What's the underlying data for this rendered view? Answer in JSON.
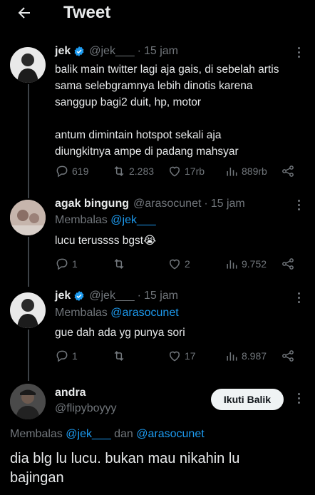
{
  "header": {
    "title": "Tweet"
  },
  "tweets": [
    {
      "name": "jek",
      "handle": "@jek___",
      "time": "15 jam",
      "text_lines": [
        "balik main twitter lagi aja gais, di sebelah artis",
        "sama selebgramnya lebih dinotis karena",
        "sanggup bagi2 duit, hp, motor",
        "",
        "antum dimintain hotspot sekali aja",
        "diungkitnya ampe di padang mahsyar"
      ],
      "replies": "619",
      "retweets": "2.283",
      "likes": "17rb",
      "views": "889rb"
    },
    {
      "name": "agak bingung",
      "handle": "@arasocunet",
      "time": "15 jam",
      "replying_label": "Membalas",
      "replying_to": "@jek___",
      "text": "lucu terussss bgst😭",
      "replies": "1",
      "retweets": "",
      "likes": "2",
      "views": "9.752"
    },
    {
      "name": "jek",
      "handle": "@jek___",
      "time": "15 jam",
      "replying_label": "Membalas",
      "replying_to": "@arasocunet",
      "text": "gue dah ada yg punya sori",
      "replies": "1",
      "retweets": "",
      "likes": "17",
      "views": "8.987"
    }
  ],
  "main_tweet": {
    "name": "andra",
    "handle": "@flipyboyyy",
    "follow_label": "Ikuti Balik",
    "replying_label": "Membalas",
    "replying_to_1": "@jek___",
    "and_label": "dan",
    "replying_to_2": "@arasocunet",
    "text_line1": "dia blg lu lucu. bukan mau nikahin lu",
    "text_line2": "bajingan"
  },
  "colors": {
    "background": "#000000",
    "text": "#e7e9ea",
    "muted": "#71767b",
    "accent": "#1d9bf0"
  }
}
